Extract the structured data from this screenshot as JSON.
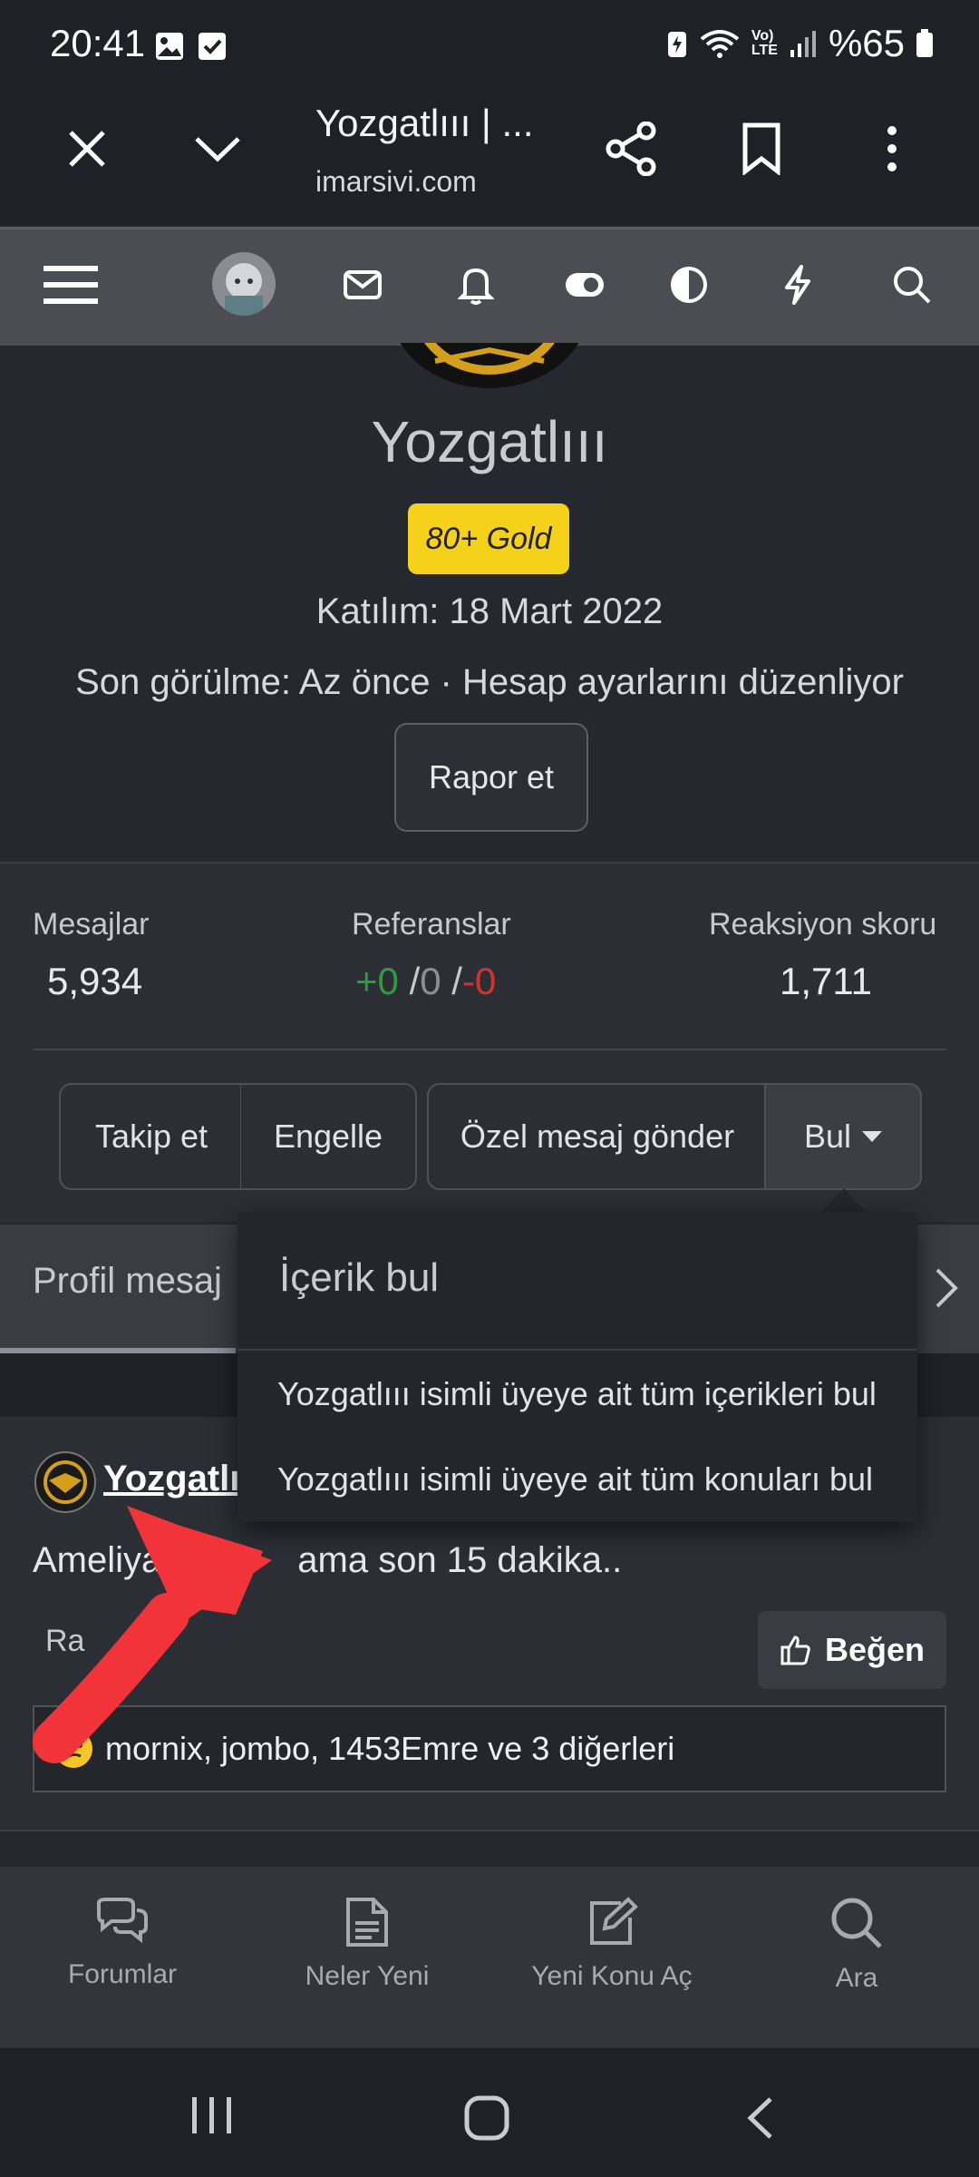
{
  "status_bar": {
    "time": "20:41",
    "battery": "%65"
  },
  "browser": {
    "title": "Yozgatlııı | ...",
    "url": "imarsivi.com"
  },
  "profile": {
    "username": "Yozgatlııı",
    "badge": "80+ Gold",
    "joined": "Katılım: 18 Mart 2022",
    "last_seen": "Son görülme: Az önce · Hesap ayarlarını düzenliyor",
    "report_label": "Rapor et",
    "badge_color": "#f6d11a"
  },
  "stats": {
    "messages_label": "Mesajlar",
    "messages_value": "5,934",
    "references_label": "Referanslar",
    "ref_positive": "+0",
    "ref_neutral": "0",
    "ref_negative": "-0",
    "reaction_label": "Reaksiyon skoru",
    "reaction_value": "1,711",
    "positive_color": "#2e9c3a",
    "negative_color": "#d2332c"
  },
  "actions": {
    "follow": "Takip et",
    "ignore": "Engelle",
    "message": "Özel mesaj gönder",
    "find": "Bul"
  },
  "tabs": {
    "profile_messages": "Profil mesaj"
  },
  "dropdown": {
    "header": "İçerik bul",
    "items": [
      "Yozgatlııı isimli üyeye ait tüm içerikleri bul",
      "Yozgatlııı isimli üyeye ait tüm konuları bul"
    ]
  },
  "post": {
    "author": "Yozgatlı",
    "text_start": "Ameliya",
    "text_end": "ama son 15 dakika..",
    "report_start": "Ra",
    "report_end": "et",
    "like_label": "Beğen",
    "reactions_text": "mornix, jombo, 1453Emre ve 3 diğerleri"
  },
  "bottom_nav": [
    "Forumlar",
    "Neler Yeni",
    "Yeni Konu Aç",
    "Ara"
  ],
  "annotation_color": "#f2343a"
}
